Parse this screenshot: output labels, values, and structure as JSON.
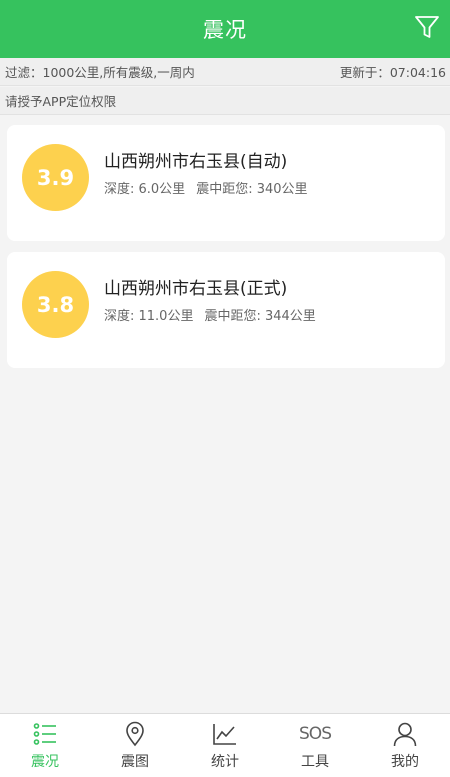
{
  "colors": {
    "accent": "#36c25e",
    "magnitude_badge": "#fdd14e"
  },
  "header": {
    "title": "震况",
    "filter_icon": "filter-icon"
  },
  "info_bar": {
    "filter_text": "过滤：1000公里,所有震级,一周内",
    "updated_text": "更新于：07:04:16"
  },
  "permission_bar": {
    "text": "请授予APP定位权限"
  },
  "quakes": [
    {
      "magnitude": "3.9",
      "place": "山西朔州市右玉县(自动)",
      "depth": "深度: 6.0公里",
      "distance": "震中距您: 340公里"
    },
    {
      "magnitude": "3.8",
      "place": "山西朔州市右玉县(正式)",
      "depth": "深度: 11.0公里",
      "distance": "震中距您: 344公里"
    }
  ],
  "bottom_nav": [
    {
      "label": "震况",
      "icon": "list-icon",
      "active": true
    },
    {
      "label": "震图",
      "icon": "map-pin-icon",
      "active": false
    },
    {
      "label": "统计",
      "icon": "chart-icon",
      "active": false
    },
    {
      "label": "工具",
      "icon": "sos-icon",
      "active": false,
      "icon_text": "SOS"
    },
    {
      "label": "我的",
      "icon": "user-icon",
      "active": false
    }
  ]
}
